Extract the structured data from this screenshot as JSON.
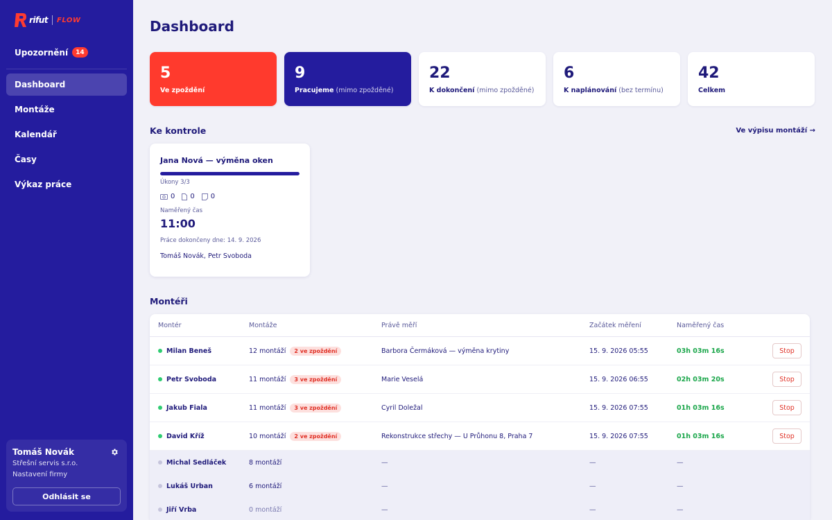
{
  "brand": {
    "name": "rifut",
    "product": "FLOW",
    "accent": "#ff3b30",
    "sidebar_bg": "#241c9e"
  },
  "sidebar": {
    "notifications": {
      "label": "Upozornění",
      "count": "14"
    },
    "nav": [
      {
        "label": "Dashboard",
        "active": true
      },
      {
        "label": "Montáže"
      },
      {
        "label": "Kalendář"
      },
      {
        "label": "Časy"
      },
      {
        "label": "Výkaz práce"
      }
    ],
    "user": {
      "name": "Tomáš Novák",
      "company": "Střešní servis s.r.o.",
      "settings_label": "Nastavení firmy",
      "logout_label": "Odhlásit se"
    }
  },
  "page_title": "Dashboard",
  "stats": [
    {
      "value": "5",
      "label": "Ve zpoždění",
      "sub": ""
    },
    {
      "value": "9",
      "label": "Pracujeme",
      "sub": "(mimo zpožděné)"
    },
    {
      "value": "22",
      "label": "K dokončení",
      "sub": "(mimo zpožděné)"
    },
    {
      "value": "6",
      "label": "K naplánování",
      "sub": "(bez termínu)"
    },
    {
      "value": "42",
      "label": "Celkem",
      "sub": ""
    }
  ],
  "review": {
    "title": "Ke kontrole",
    "link": "Ve výpisu montáží →",
    "card": {
      "title": "Jana Nová — výměna oken",
      "progress": 1.0,
      "tasks": "Úkony 3/3",
      "photos": "0",
      "docs": "0",
      "notes": "0",
      "time_label": "Naměřený čas",
      "time": "11:00",
      "completed": "Práce dokončeny dne: 14. 9. 2026",
      "workers": "Tomáš Novák, Petr Svoboda"
    }
  },
  "workers": {
    "title": "Montéři",
    "columns": [
      "Montér",
      "Montáže",
      "Právě měří",
      "Začátek měření",
      "Naměřený čas"
    ],
    "stop_label": "Stop",
    "active_rows": [
      {
        "name": "Milan Beneš",
        "count": "12 montáží",
        "late": "2 ve zpoždění",
        "current": "Barbora Čermáková — výměna krytiny",
        "start": "15. 9. 2026 05:55",
        "time": "03h 03m 16s"
      },
      {
        "name": "Petr Svoboda",
        "count": "11 montáží",
        "late": "3 ve zpoždění",
        "current": "Marie Veselá",
        "start": "15. 9. 2026 06:55",
        "time": "02h 03m 20s"
      },
      {
        "name": "Jakub Fiala",
        "count": "11 montáží",
        "late": "3 ve zpoždění",
        "current": "Cyril Doležal",
        "start": "15. 9. 2026 07:55",
        "time": "01h 03m 16s"
      },
      {
        "name": "David Kříž",
        "count": "10 montáží",
        "late": "2 ve zpoždění",
        "current": "Rekonstrukce střechy — U Průhonu 8, Praha 7",
        "start": "15. 9. 2026 07:55",
        "time": "01h 03m 16s"
      }
    ],
    "idle_rows": [
      {
        "name": "Michal Sedláček",
        "count": "8 montáží",
        "current": "—",
        "start": "—",
        "time": "—"
      },
      {
        "name": "Lukáš Urban",
        "count": "6 montáží",
        "current": "—",
        "start": "—",
        "time": "—"
      },
      {
        "name": "Jiří Vrba",
        "count": "0 montáží",
        "current": "—",
        "start": "—",
        "time": "—"
      }
    ]
  }
}
